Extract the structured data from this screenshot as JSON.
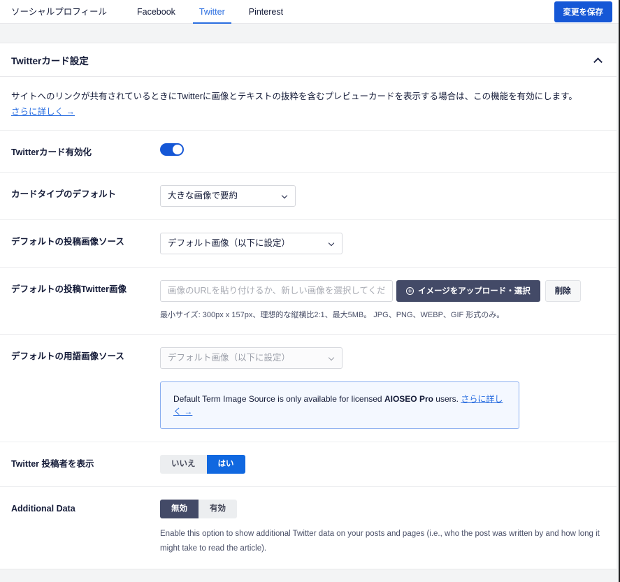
{
  "topbar": {
    "social_profiles_label": "ソーシャルプロフィール",
    "tabs": [
      {
        "label": "Facebook",
        "active": false
      },
      {
        "label": "Twitter",
        "active": true
      },
      {
        "label": "Pinterest",
        "active": false
      }
    ],
    "save_button": "変更を保存"
  },
  "card": {
    "title": "Twitterカード設定",
    "collapse_icon": "chevron-up-icon",
    "intro_text": "サイトへのリンクが共有されているときにTwitterに画像とテキストの抜粋を含むプレビューカードを表示する場合は、この機能を有効にします。",
    "intro_link": "さらに詳しく →"
  },
  "rows": {
    "enable_card": {
      "label": "Twitterカード有効化",
      "toggle_state": "on"
    },
    "card_type": {
      "label": "カードタイプのデフォルト",
      "value": "大きな画像で要約"
    },
    "post_image_source": {
      "label": "デフォルトの投稿画像ソース",
      "value": "デフォルト画像（以下に設定）"
    },
    "post_twitter_image": {
      "label": "デフォルトの投稿Twitter画像",
      "input_value": "",
      "input_placeholder": "画像のURLを貼り付けるか、新しい画像を選択してください",
      "upload_button": "イメージをアップロード・選択",
      "delete_button": "削除",
      "helper": "最小サイズ: 300px x 157px、理想的な縦横比2:1、最大5MB。 JPG、PNG、WEBP、GIF 形式のみ。"
    },
    "term_image_source": {
      "label": "デフォルトの用語画像ソース",
      "value": "デフォルト画像（以下に設定）",
      "notice_prefix": "Default Term Image Source is only available for licensed ",
      "notice_bold": "AIOSEO Pro",
      "notice_suffix": " users. ",
      "notice_link": "さらに詳しく →"
    },
    "show_author": {
      "label": "Twitter 投稿者を表示",
      "options": [
        "いいえ",
        "はい"
      ],
      "selected": "はい"
    },
    "additional_data": {
      "label": "Additional Data",
      "options": [
        "無効",
        "有効"
      ],
      "selected": "無効",
      "description": "Enable this option to show additional Twitter data on your posts and pages (i.e., who the post was written by and how long it might take to read the article)."
    }
  },
  "colors": {
    "accent_blue": "#1557d6",
    "tab_blue": "#2a6ee0",
    "dark_navy": "#434a67",
    "page_bg": "#f3f4f5"
  }
}
